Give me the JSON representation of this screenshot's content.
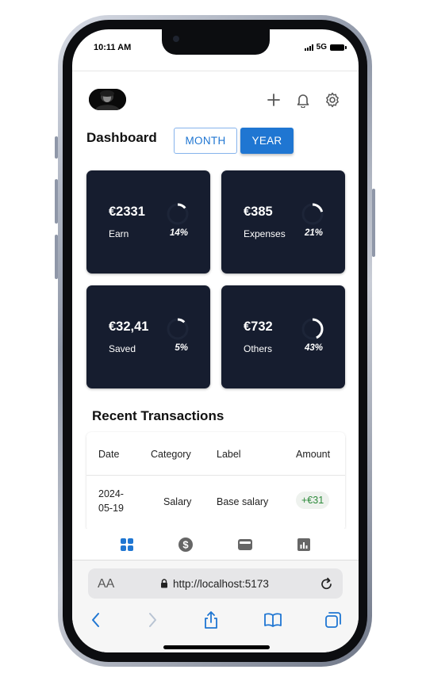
{
  "status_bar": {
    "time": "10:11 AM",
    "network": "5G"
  },
  "header": {
    "avatar": "user-avatar",
    "icons": [
      "add-icon",
      "bell-icon",
      "gear-icon"
    ]
  },
  "dashboard": {
    "title": "Dashboard",
    "toggle": {
      "month": "MONTH",
      "year": "YEAR",
      "selected": "YEAR"
    },
    "accent_color": "#1f76d2",
    "card_color": "#161d2f",
    "cards": [
      {
        "amount": "€2331",
        "label": "Earn",
        "percent": "14%",
        "progress": 0.14
      },
      {
        "amount": "€385",
        "label": "Expenses",
        "percent": "21%",
        "progress": 0.21
      },
      {
        "amount": "€32,41",
        "label": "Saved",
        "percent": "5%",
        "progress": 0.05
      },
      {
        "amount": "€732",
        "label": "Others",
        "percent": "43%",
        "progress": 0.43
      }
    ]
  },
  "transactions": {
    "title": "Recent Transactions",
    "columns": [
      "Date",
      "Category",
      "Label",
      "Amount"
    ],
    "rows": [
      {
        "date_line1": "2024-",
        "date_line2": "05-19",
        "category": "Salary",
        "label": "Base salary",
        "amount": "+€31"
      }
    ],
    "positive_color": "#2c8a3a"
  },
  "bottom_nav": {
    "items": [
      "dashboard-icon",
      "dollar-icon",
      "wallet-icon",
      "chart-icon"
    ],
    "active": "dashboard-icon"
  },
  "browser": {
    "text_size_label": "AA",
    "url": "http://localhost:5173",
    "toolbar": [
      "back-icon",
      "forward-icon",
      "share-icon",
      "bookmarks-icon",
      "tabs-icon"
    ]
  }
}
